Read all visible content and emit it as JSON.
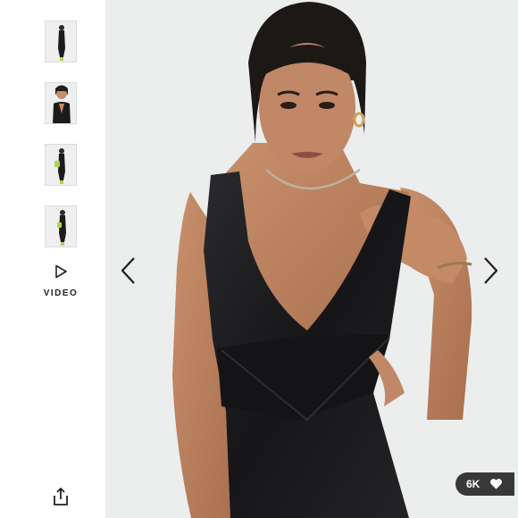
{
  "gallery": {
    "thumbnails": [
      {
        "alt": "thumbnail-1",
        "pose": "full-length"
      },
      {
        "alt": "thumbnail-2",
        "pose": "close-up"
      },
      {
        "alt": "thumbnail-3",
        "pose": "full-length-bag"
      },
      {
        "alt": "thumbnail-4",
        "pose": "full-length-side"
      }
    ],
    "video_label": "VIDEO",
    "play_icon": "play-icon",
    "share_icon": "share-icon"
  },
  "viewer": {
    "prev_icon": "chevron-left-icon",
    "next_icon": "chevron-right-icon",
    "likes": {
      "count": "6K",
      "icon": "heart-icon"
    }
  },
  "colors": {
    "background": "#ffffff",
    "photo_backdrop": "#eceded",
    "dress": "#1a1a1c",
    "badge": "#282828"
  }
}
